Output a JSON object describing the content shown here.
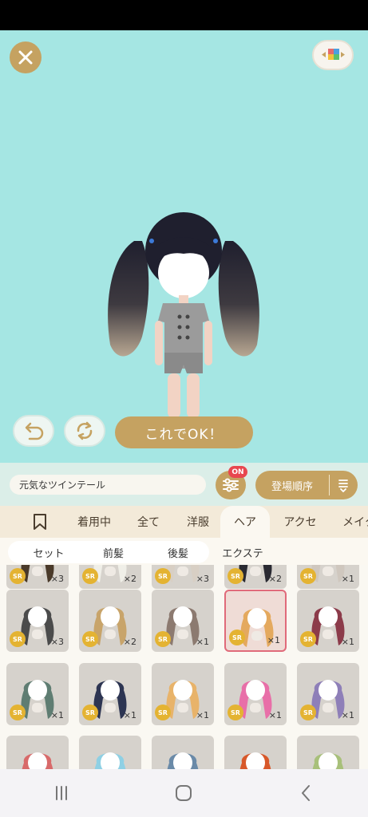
{
  "top_bar": {
    "close_icon": "close-icon",
    "palette_icon": "palette-icon"
  },
  "actions": {
    "undo_icon": "undo-icon",
    "random_icon": "refresh-icon",
    "confirm_label": "これでOK！"
  },
  "control_bar": {
    "item_name": "元気なツインテール",
    "filter_badge": "ON",
    "sort_label": "登場順序"
  },
  "tabs": [
    {
      "label": ""
    },
    {
      "label": "着用中"
    },
    {
      "label": "全て"
    },
    {
      "label": "洋服"
    },
    {
      "label": "ヘア"
    },
    {
      "label": "アクセ"
    },
    {
      "label": "メイク"
    }
  ],
  "sub_tabs": [
    {
      "label": "セット"
    },
    {
      "label": "前髪"
    },
    {
      "label": "後髪"
    },
    {
      "label": "エクステ"
    }
  ],
  "grid": {
    "rows": [
      [
        {
          "rarity": "SR",
          "count": "×3",
          "hair": "#4a3a2a"
        },
        {
          "rarity": "SR",
          "count": "×2",
          "hair": "#f0efe8"
        },
        {
          "rarity": "SR",
          "count": "×3",
          "hair": "#d8cfc4"
        },
        {
          "rarity": "SR",
          "count": "×2",
          "hair": "#2a2a32"
        },
        {
          "rarity": "SR",
          "count": "×1",
          "hair": "#cfc7be"
        }
      ],
      [
        {
          "rarity": "SR",
          "count": "×3",
          "hair": "#4b4b4b"
        },
        {
          "rarity": "SR",
          "count": "×2",
          "hair": "#c8a46a"
        },
        {
          "rarity": "SR",
          "count": "×1",
          "hair": "#8c7a70"
        },
        {
          "rarity": "SR",
          "count": "×1",
          "hair": "#e4a95e"
        },
        {
          "rarity": "SR",
          "count": "×1",
          "hair": "#8c3b4a"
        }
      ],
      [
        {
          "rarity": "SR",
          "count": "×1",
          "hair": "#5f7d72"
        },
        {
          "rarity": "SR",
          "count": "×1",
          "hair": "#2d3552"
        },
        {
          "rarity": "SR",
          "count": "×1",
          "hair": "#e8b36a"
        },
        {
          "rarity": "SR",
          "count": "×1",
          "hair": "#e86fa8"
        },
        {
          "rarity": "SR",
          "count": "×1",
          "hair": "#8e7fb8"
        }
      ],
      [
        {
          "rarity": "",
          "count": "",
          "hair": "#d86a6a"
        },
        {
          "rarity": "",
          "count": "",
          "hair": "#8fd0e4"
        },
        {
          "rarity": "",
          "count": "",
          "hair": "#6a8aa8"
        },
        {
          "rarity": "",
          "count": "",
          "hair": "#d8582a"
        },
        {
          "rarity": "",
          "count": "",
          "hair": "#a8c07a"
        }
      ]
    ]
  },
  "nav": {
    "recents_icon": "recents-icon",
    "home_icon": "home-icon",
    "back_icon": "back-icon"
  },
  "colors": {
    "stage_bg": "#a5e6e3",
    "accent_gold": "#c5a261",
    "selected_border": "#e06a7a",
    "sr_badge": "#e4b332"
  }
}
